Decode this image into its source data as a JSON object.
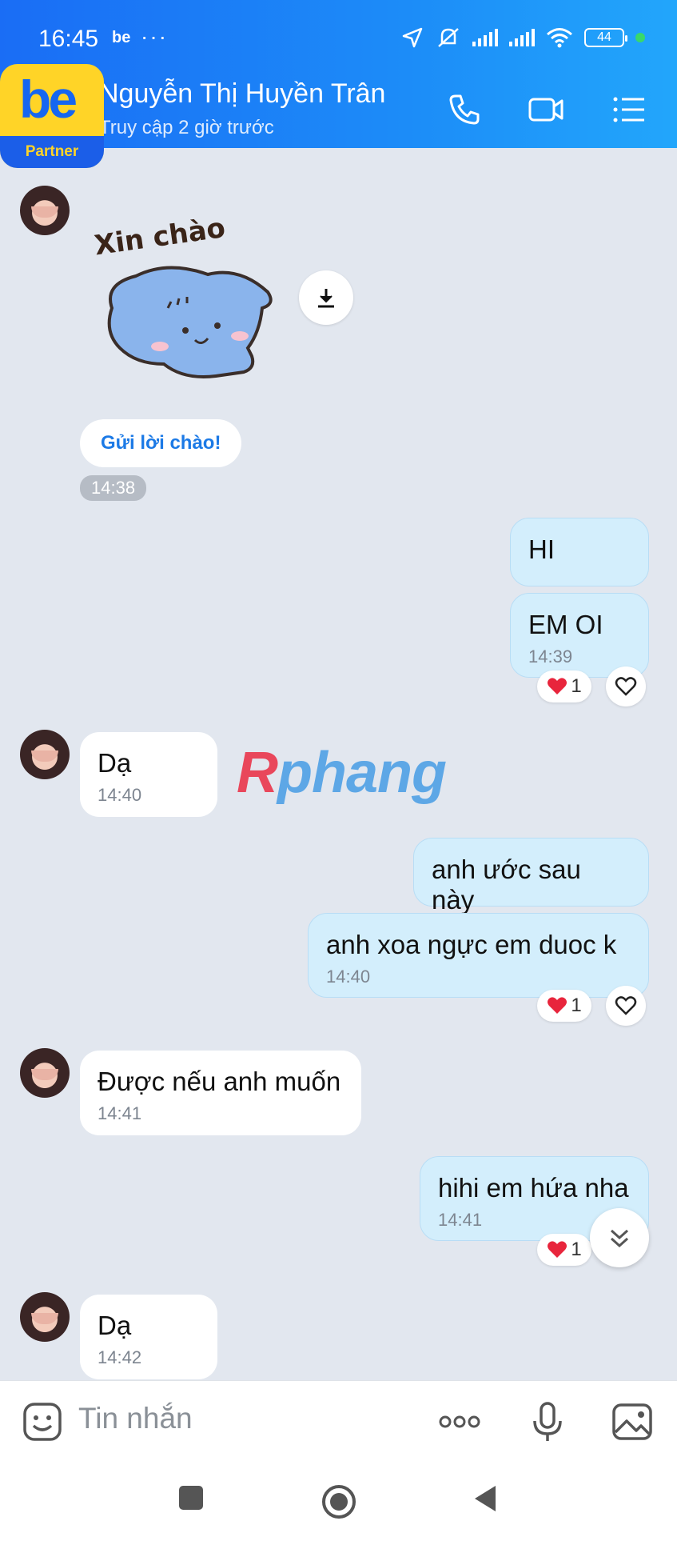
{
  "status_bar": {
    "time": "16:45",
    "app_badge": "be",
    "more": "···",
    "battery": "44"
  },
  "logo": {
    "brand": "be",
    "tag": "Partner"
  },
  "header": {
    "contact_name": "Nguyễn Thị Huyền Trân",
    "last_seen": "Truy cập 2 giờ trước"
  },
  "messages": {
    "sticker_caption": "Xin chào",
    "greet_button": "Gửi lời chào!",
    "time_1438": "14:38",
    "m1": {
      "text": "HI"
    },
    "m2": {
      "text": "EM OI",
      "time": "14:39",
      "react_count": "1"
    },
    "m3": {
      "text": "Dạ",
      "time": "14:40"
    },
    "m4": {
      "text": "anh ước sau này"
    },
    "m5": {
      "text": "anh xoa ngực em duoc  k",
      "time": "14:40",
      "react_count": "1"
    },
    "m6": {
      "text": "Được nếu anh muốn",
      "time": "14:41"
    },
    "m7": {
      "text": "hihi em hứa nha",
      "time": "14:41",
      "react_count": "1"
    },
    "m8": {
      "text": "Dạ",
      "time": "14:42"
    }
  },
  "watermark": {
    "first": "R",
    "rest": "phang"
  },
  "input": {
    "placeholder": "Tin nhắn",
    "more": "ooo"
  },
  "colors": {
    "header": "#1c8cf8",
    "outgoing": "#d3eefc",
    "incoming": "#ffffff",
    "background": "#e2e7ef",
    "heart": "#e8253c"
  }
}
